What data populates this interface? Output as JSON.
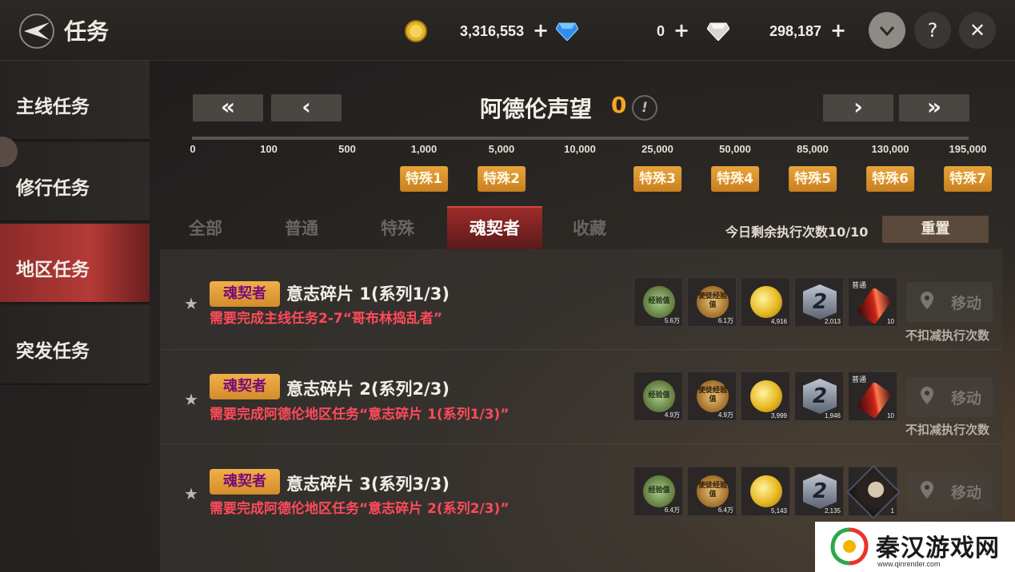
{
  "header": {
    "title": "任务",
    "gold": "3,316,553",
    "blue_gem": "0",
    "diamond": "298,187",
    "plus": "+",
    "help": "?",
    "close": "✕"
  },
  "sidebar": {
    "items": [
      {
        "label": "主线任务",
        "active": false
      },
      {
        "label": "修行任务",
        "active": false
      },
      {
        "label": "地区任务",
        "active": true
      },
      {
        "label": "突发任务",
        "active": false
      }
    ]
  },
  "reputation": {
    "first": "«",
    "prev": "‹",
    "next": "›",
    "last": "»",
    "title": "阿德伦声望",
    "value": "0",
    "info": "!",
    "ticks": [
      "0",
      "100",
      "500",
      "1,000",
      "5,000",
      "10,000",
      "25,000",
      "50,000",
      "85,000",
      "130,000",
      "195,000"
    ],
    "badges": [
      "特殊1",
      "特殊2",
      "特殊3",
      "特殊4",
      "特殊5",
      "特殊6",
      "特殊7"
    ]
  },
  "tabs": [
    {
      "label": "全部",
      "active": false
    },
    {
      "label": "普通",
      "active": false
    },
    {
      "label": "特殊",
      "active": false
    },
    {
      "label": "魂契者",
      "active": true
    },
    {
      "label": "收藏",
      "active": false
    }
  ],
  "remaining": "今日剩余执行次数10/10",
  "reset_label": "重置",
  "quests": [
    {
      "tag": "魂契者",
      "name": "意志碎片 1(系列1/3)",
      "requirement": "需要完成主线任务2-7“哥布林捣乱者”",
      "rewards": [
        {
          "kind": "exp",
          "label": "经验值",
          "count": "5.6万"
        },
        {
          "kind": "sexp",
          "label": "使徒经验值",
          "count": "6.1万"
        },
        {
          "kind": "gold",
          "count": "4,916"
        },
        {
          "kind": "rank",
          "label": "2",
          "count": "2,013"
        },
        {
          "kind": "potion",
          "top": "普通",
          "count": "10"
        }
      ],
      "move": "移动",
      "note": "不扣减执行次数"
    },
    {
      "tag": "魂契者",
      "name": "意志碎片 2(系列2/3)",
      "requirement": "需要完成阿德伦地区任务“意志碎片 1(系列1/3)”",
      "rewards": [
        {
          "kind": "exp",
          "label": "经验值",
          "count": "4.9万"
        },
        {
          "kind": "sexp",
          "label": "使徒经验值",
          "count": "4.9万"
        },
        {
          "kind": "gold",
          "count": "3,999"
        },
        {
          "kind": "rank",
          "label": "2",
          "count": "1,946"
        },
        {
          "kind": "potion",
          "top": "普通",
          "count": "10"
        }
      ],
      "move": "移动",
      "note": "不扣减执行次数"
    },
    {
      "tag": "魂契者",
      "name": "意志碎片 3(系列3/3)",
      "requirement": "需要完成阿德伦地区任务“意志碎片 2(系列2/3)”",
      "rewards": [
        {
          "kind": "exp",
          "label": "经验值",
          "count": "6.4万"
        },
        {
          "kind": "sexp",
          "label": "使徒经验值",
          "count": "6.4万"
        },
        {
          "kind": "gold",
          "count": "5,143"
        },
        {
          "kind": "rank",
          "label": "2",
          "count": "2,135"
        },
        {
          "kind": "portrait",
          "count": "1"
        }
      ],
      "move": "移动",
      "note": ""
    }
  ],
  "watermark": {
    "text": "秦汉游戏网",
    "url": "www.qinrender.com"
  }
}
